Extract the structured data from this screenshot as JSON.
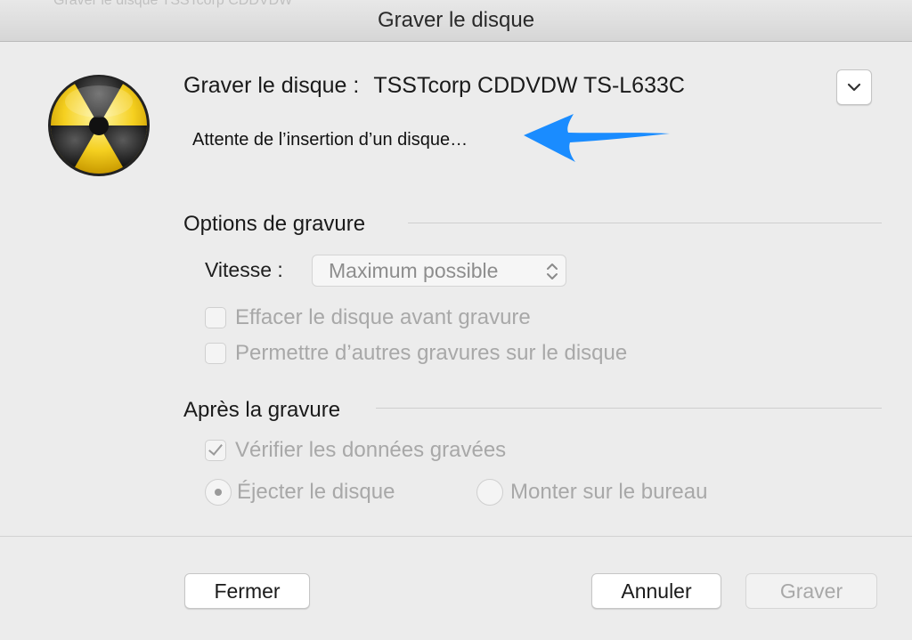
{
  "window": {
    "title": "Graver le disque",
    "background_text": "Graver le disque TSSTcorp CDDVDW"
  },
  "header": {
    "label": "Graver le disque :",
    "device": "TSSTcorp CDDVDW TS-L633C",
    "status": "Attente de l’insertion d’un disque…",
    "icon": "burn-icon",
    "arrow_color": "#1a8cff"
  },
  "options": {
    "title": "Options de gravure",
    "speed_label": "Vitesse :",
    "speed_value": "Maximum possible",
    "erase": {
      "label": "Effacer le disque avant gravure",
      "checked": false
    },
    "append": {
      "label": "Permettre d’autres gravures sur le disque",
      "checked": false
    }
  },
  "after": {
    "title": "Après la gravure",
    "verify": {
      "label": "Vérifier les données gravées",
      "checked": true
    },
    "eject": {
      "label": "Éjecter le disque",
      "selected": true
    },
    "mount": {
      "label": "Monter sur le bureau",
      "selected": false
    }
  },
  "buttons": {
    "close": "Fermer",
    "cancel": "Annuler",
    "burn": "Graver"
  }
}
